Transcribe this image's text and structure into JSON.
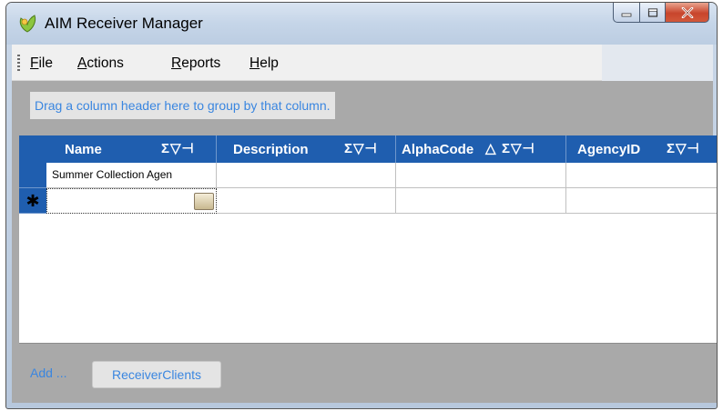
{
  "window": {
    "title": "AIM Receiver Manager",
    "controls": {
      "minimize": "minimize-icon",
      "maximize": "maximize-icon",
      "close": "close-icon"
    }
  },
  "menu": {
    "items": [
      {
        "pre": "",
        "accel": "F",
        "post": "ile"
      },
      {
        "pre": "",
        "accel": "A",
        "post": "ctions"
      },
      {
        "pre": "",
        "accel": "R",
        "post": "eports"
      },
      {
        "pre": "",
        "accel": "H",
        "post": "elp"
      }
    ]
  },
  "grid": {
    "group_hint": "Drag a column header here to group by that column.",
    "columns": [
      {
        "label": "Name",
        "icons": "Σ▽⊣",
        "sort": ""
      },
      {
        "label": "Description",
        "icons": "Σ▽⊣",
        "sort": ""
      },
      {
        "label": "AlphaCode",
        "icons": "Σ▽⊣",
        "sort": "△"
      },
      {
        "label": "AgencyID",
        "icons": "Σ▽⊣",
        "sort": ""
      }
    ],
    "rows": [
      {
        "name": "Summer Collection Agen",
        "description": "",
        "alphacode": "",
        "agencyid": ""
      }
    ],
    "new_row_marker": "✱"
  },
  "footer": {
    "add_label": "Add ...",
    "receiver_clients_label": "ReceiverClients"
  },
  "colors": {
    "header_blue": "#1f5eaf",
    "link_blue": "#3a86e0",
    "panel_gray": "#a9a9a9"
  }
}
